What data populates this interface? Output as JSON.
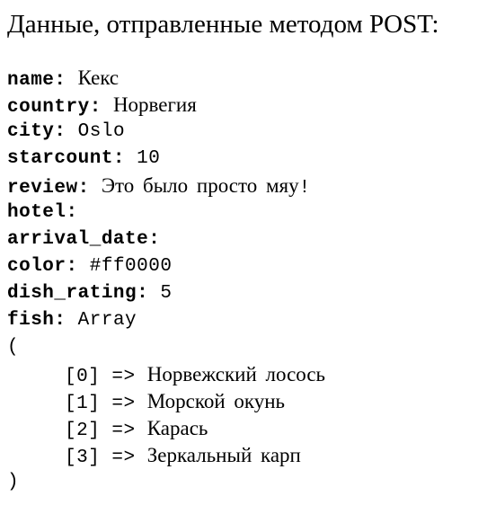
{
  "heading": "Данные, отправленные методом POST:",
  "fields": [
    {
      "key": "name",
      "value": "Кекс"
    },
    {
      "key": "country",
      "value": "Норвегия"
    },
    {
      "key": "city",
      "value": "Oslo"
    },
    {
      "key": "starcount",
      "value": "10"
    },
    {
      "key": "review",
      "value": "Это было просто мяу",
      "suffix": "!"
    },
    {
      "key": "hotel",
      "value": ""
    },
    {
      "key": "arrival_date",
      "value": ""
    },
    {
      "key": "color",
      "value": "#ff0000"
    },
    {
      "key": "dish_rating",
      "value": "5"
    },
    {
      "key": "fish",
      "value": "Array"
    }
  ],
  "array": {
    "open": "(",
    "arrow": "=>",
    "items": [
      {
        "index": "[0]",
        "value": "Норвежский лосось"
      },
      {
        "index": "[1]",
        "value": "Морской окунь"
      },
      {
        "index": "[2]",
        "value": "Карась"
      },
      {
        "index": "[3]",
        "value": "Зеркальный карп"
      }
    ],
    "close": ")"
  }
}
